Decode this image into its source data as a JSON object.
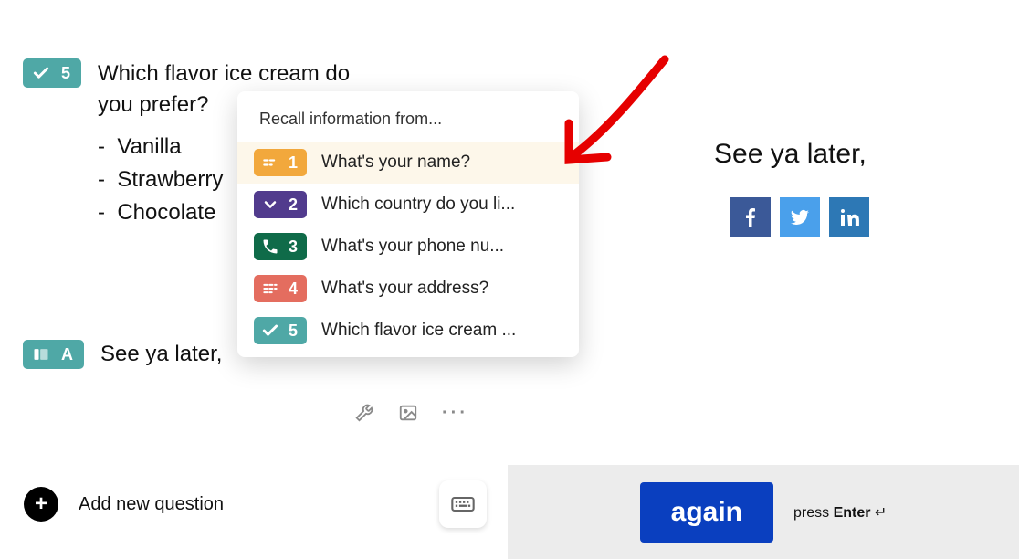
{
  "left": {
    "q5": {
      "badge_number": "5",
      "question": "Which flavor ice cream do you prefer?",
      "options": [
        "Vanilla",
        "Strawberry",
        "Chocolate"
      ]
    },
    "qa": {
      "badge_letter": "A",
      "text": "See ya later,"
    },
    "add_new_label": "Add new question"
  },
  "recall": {
    "title": "Recall information from...",
    "items": [
      {
        "num": "1",
        "label": "What's your name?",
        "color": "orange",
        "icon": "short-text"
      },
      {
        "num": "2",
        "label": "Which country do you li...",
        "color": "purple",
        "icon": "chevron-down"
      },
      {
        "num": "3",
        "label": "What's your phone nu...",
        "color": "green",
        "icon": "phone"
      },
      {
        "num": "4",
        "label": "What's your address?",
        "color": "coral",
        "icon": "long-text"
      },
      {
        "num": "5",
        "label": "Which flavor ice cream ...",
        "color": "teal",
        "icon": "check"
      }
    ]
  },
  "preview": {
    "text": "See ya later,",
    "button_label": "again",
    "hint_prefix": "press ",
    "hint_key": "Enter"
  }
}
